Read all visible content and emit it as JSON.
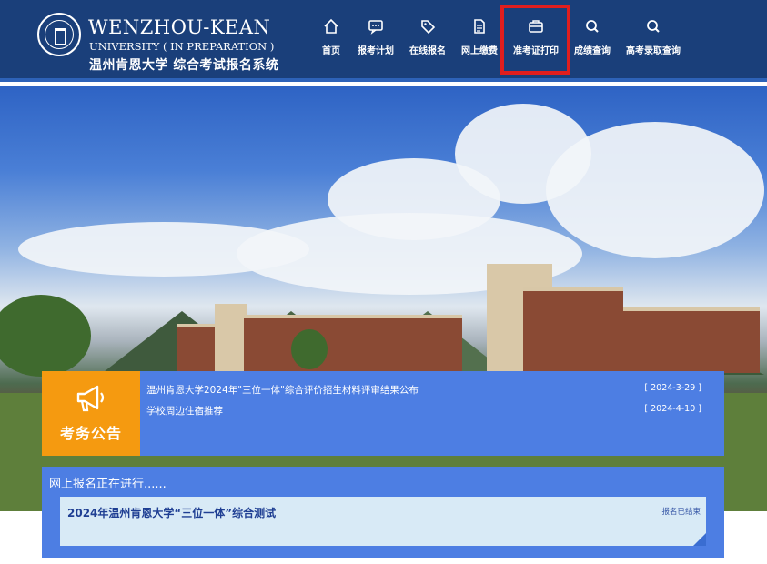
{
  "brand": {
    "name_en": "WENZHOU-KEAN",
    "sub_en": "UNIVERSITY ( IN PREPARATION )",
    "name_cn": "温州肯恩大学  综合考试报名系统"
  },
  "nav": {
    "items": [
      {
        "label": "首页",
        "icon": "home-icon"
      },
      {
        "label": "报考计划",
        "icon": "message-icon"
      },
      {
        "label": "在线报名",
        "icon": "tag-icon"
      },
      {
        "label": "网上缴费",
        "icon": "document-icon"
      },
      {
        "label": "准考证打印",
        "icon": "briefcase-icon"
      },
      {
        "label": "成绩查询",
        "icon": "search-icon"
      },
      {
        "label": "高考录取查询",
        "icon": "search-icon"
      }
    ],
    "highlight_color": "#e01e1e"
  },
  "notice": {
    "label": "考务公告",
    "items": [
      {
        "title": "温州肯恩大学2024年\"三位一体\"综合评价招生材料评审结果公布",
        "date": "[ 2024-3-29 ]"
      },
      {
        "title": "学校周边住宿推荐",
        "date": "[ 2024-4-10 ]"
      }
    ]
  },
  "registration": {
    "title": "网上报名正在进行......",
    "card": {
      "title": "2024年温州肯恩大学“三位一体”综合测试",
      "status": "报名已结束"
    }
  },
  "colors": {
    "header_bg": "#1a3f7a",
    "panel_bg": "#4d7ee3",
    "notice_label_bg": "#f59a10",
    "card_bg": "#d8eaf6"
  }
}
